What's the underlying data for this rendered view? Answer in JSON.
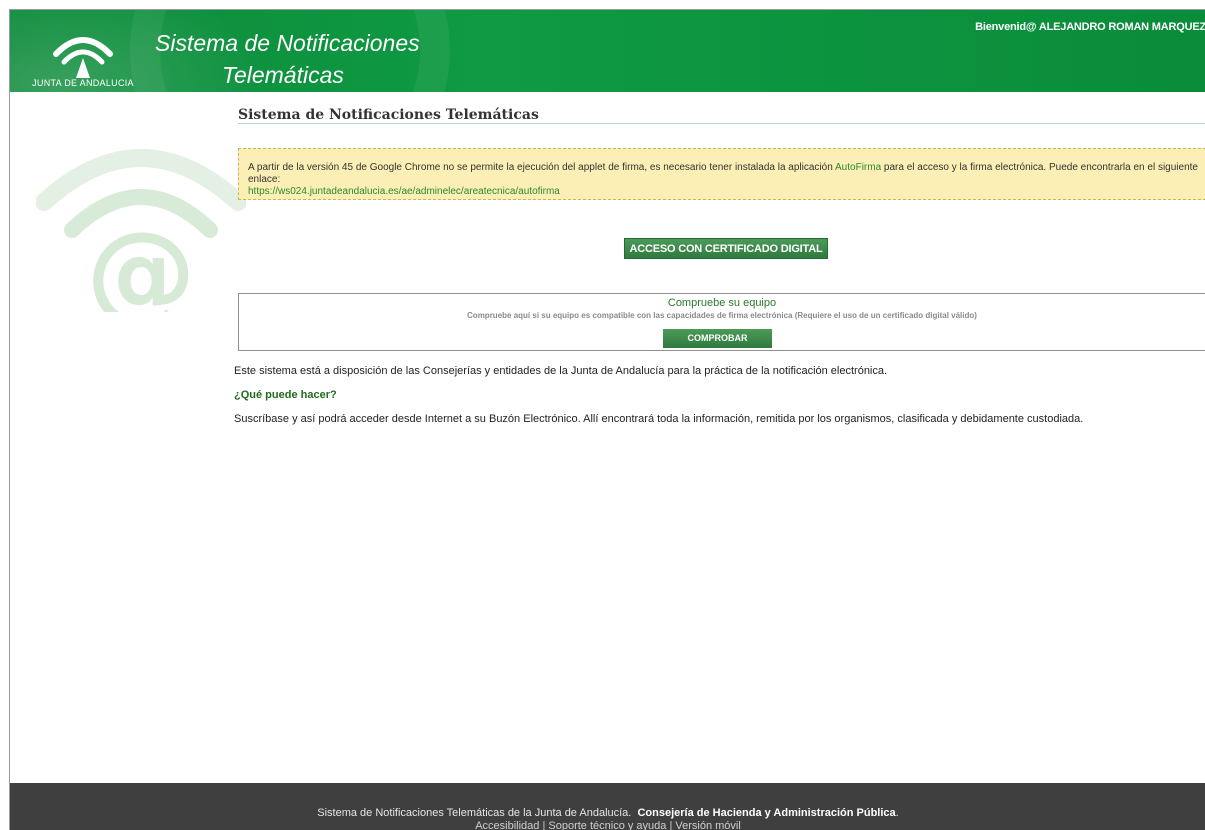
{
  "header": {
    "logo_text": "JUNTA DE ANDALUCIA",
    "title_line1": "Sistema de Notificaciones",
    "title_line2": "Telemáticas",
    "welcome_prefix": "Bienvenid@ ",
    "welcome_name": "ALEJANDRO ROMAN MARQUEZ",
    "colors": {
      "brand_green": "#0f9a43"
    }
  },
  "main": {
    "page_title": "Sistema de Notificaciones Telemáticas",
    "notice": {
      "text_before_link": "A partir de la versión 45 de Google Chrome no se permite la ejecución del applet de firma, es necesario tener instalada la aplicación ",
      "link_label": "AutoFirma",
      "text_after_link": " para el acceso y la firma electrónica. Puede encontrarla en el siguiente enlace:",
      "url": "https://ws024.juntadeandalucia.es/ae/adminelec/areatecnica/autofirma"
    },
    "cert_button_label": "ACCESO CON CERTIFICADO DIGITAL",
    "check": {
      "title": "Compruebe su equipo",
      "description": "Compruebe  aquí  si su equipo es compatible  con las capacidades de firma electrónica (Requiere el uso de un certificado digital válido)",
      "button_label": "COMPROBAR"
    },
    "intro": "Este sistema está a disposición de las Consejerías y entidades de la Junta de Andalucía para la práctica de la notificación electrónica.",
    "what_heading": "¿Qué puede hacer?",
    "what_text": "Suscríbase y así podrá acceder desde Internet a su Buzón Electrónico. Allí encontrará toda la información, remitida por los organismos, clasificada y debidamente custodiada."
  },
  "footer": {
    "line1_text": "Sistema de Notificaciones Telemáticas de la Junta de Andalucía.",
    "line1_bold": "Consejería de Hacienda y Administración Pública",
    "line1_end": ".",
    "links": [
      "Accesibilidad",
      "Soporte técnico y ayuda",
      "Versión móvil"
    ],
    "separator": " | "
  }
}
